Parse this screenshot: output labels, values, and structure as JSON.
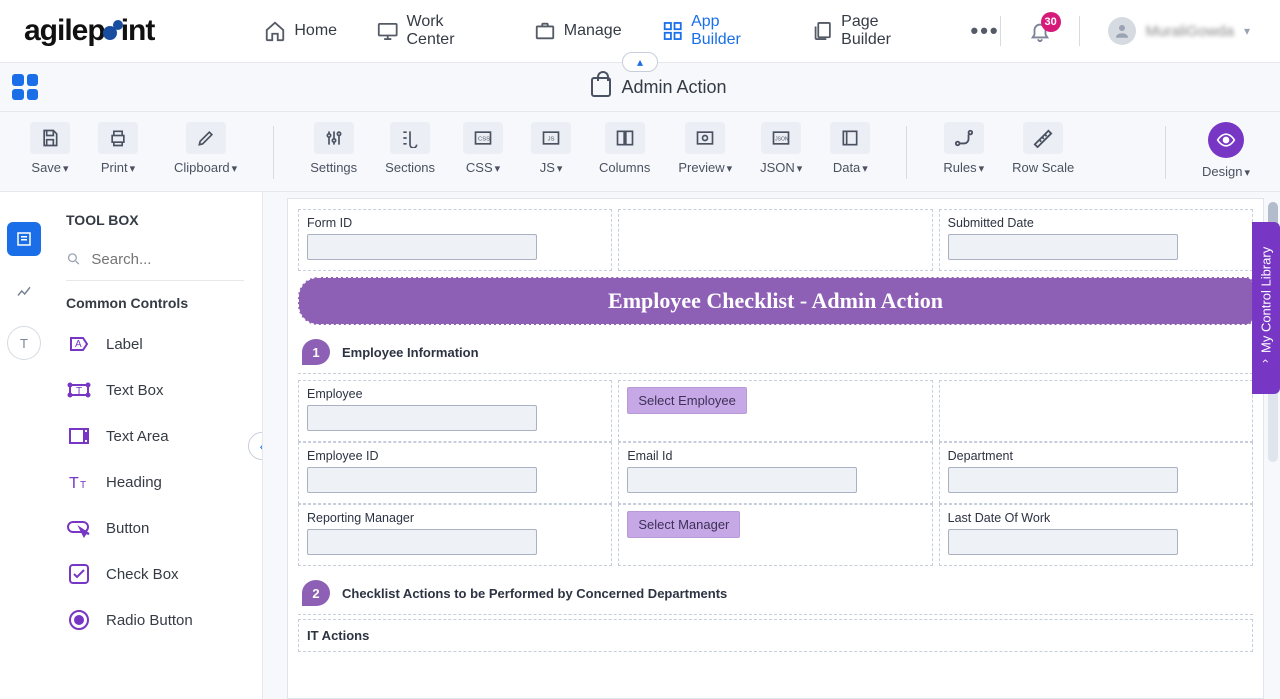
{
  "nav": {
    "brand": "agilepoint",
    "items": [
      {
        "label": "Home"
      },
      {
        "label": "Work Center"
      },
      {
        "label": "Manage"
      },
      {
        "label": "App Builder",
        "active": true
      },
      {
        "label": "Page Builder"
      }
    ],
    "notification_count": "30",
    "username": "MuraliGowda"
  },
  "title": "Admin Action",
  "toolbar": {
    "save": "Save",
    "print": "Print",
    "clipboard": "Clipboard",
    "settings": "Settings",
    "sections": "Sections",
    "css": "CSS",
    "js": "JS",
    "columns": "Columns",
    "preview": "Preview",
    "json": "JSON",
    "data": "Data",
    "rules": "Rules",
    "rowscale": "Row Scale",
    "design": "Design"
  },
  "toolbox": {
    "heading": "TOOL BOX",
    "search_placeholder": "Search...",
    "section": "Common Controls",
    "controls": [
      "Label",
      "Text Box",
      "Text Area",
      "Heading",
      "Button",
      "Check Box",
      "Radio Button"
    ]
  },
  "form": {
    "form_id_label": "Form ID",
    "submitted_label": "Submitted Date",
    "banner": "Employee Checklist - Admin Action",
    "sec1_num": "1",
    "sec1_title": "Employee Information",
    "employee": "Employee",
    "select_employee": "Select Employee",
    "employee_id": "Employee ID",
    "email": "Email Id",
    "dept": "Department",
    "manager": "Reporting Manager",
    "select_manager": "Select Manager",
    "lastdate": "Last Date Of Work",
    "sec2_num": "2",
    "sec2_title": "Checklist Actions to be Performed by Concerned Departments",
    "it_actions": "IT Actions"
  },
  "drawer": "My Control Library"
}
